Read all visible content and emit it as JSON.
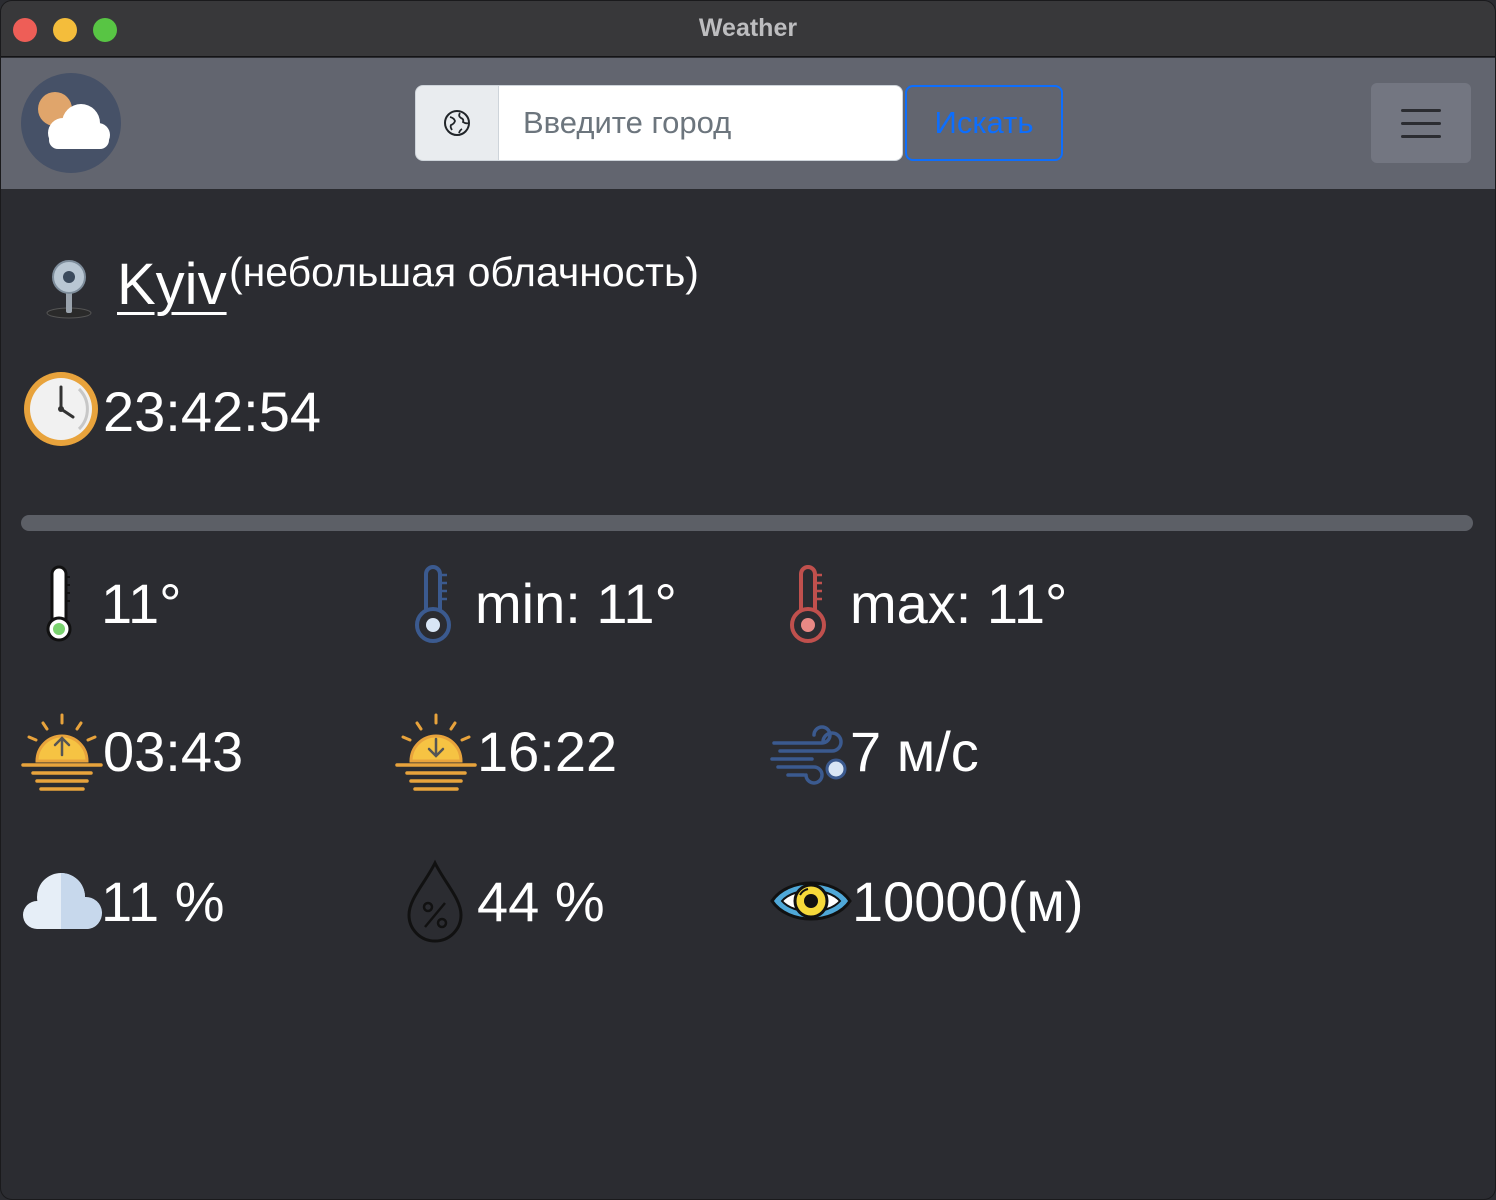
{
  "window": {
    "title": "Weather"
  },
  "navbar": {
    "search_placeholder": "Введите город",
    "search_button": "Искать"
  },
  "location": {
    "city": "Kyiv",
    "description": "(небольшая облачность)"
  },
  "time": {
    "current": "23:42:54"
  },
  "stats": {
    "temp": "11°",
    "temp_min": "min: 11°",
    "temp_max": "max: 11°",
    "sunrise": "03:43",
    "sunset": "16:22",
    "wind": "7 м/с",
    "clouds": "11 %",
    "humidity": "44 %",
    "visibility": "10000(м)"
  },
  "icons": {
    "logo": "sun-behind-cloud-icon",
    "search_addon": "globe-icon",
    "menu": "hamburger-menu-icon",
    "location": "map-pin-icon",
    "time": "clock-icon",
    "temp": "thermometer-icon",
    "temp_min": "thermometer-cold-icon",
    "temp_max": "thermometer-hot-icon",
    "sunrise": "sunrise-icon",
    "sunset": "sunset-icon",
    "wind": "wind-icon",
    "clouds": "cloud-icon",
    "humidity": "humidity-drop-icon",
    "visibility": "eye-icon"
  },
  "colors": {
    "background": "#2b2c31",
    "navbar": "#62656f",
    "accent": "#0d6efd",
    "sun": "#f6c343",
    "sun_rays": "#e8a33c",
    "cold": "#3b5a8f",
    "hot": "#c0504d"
  }
}
